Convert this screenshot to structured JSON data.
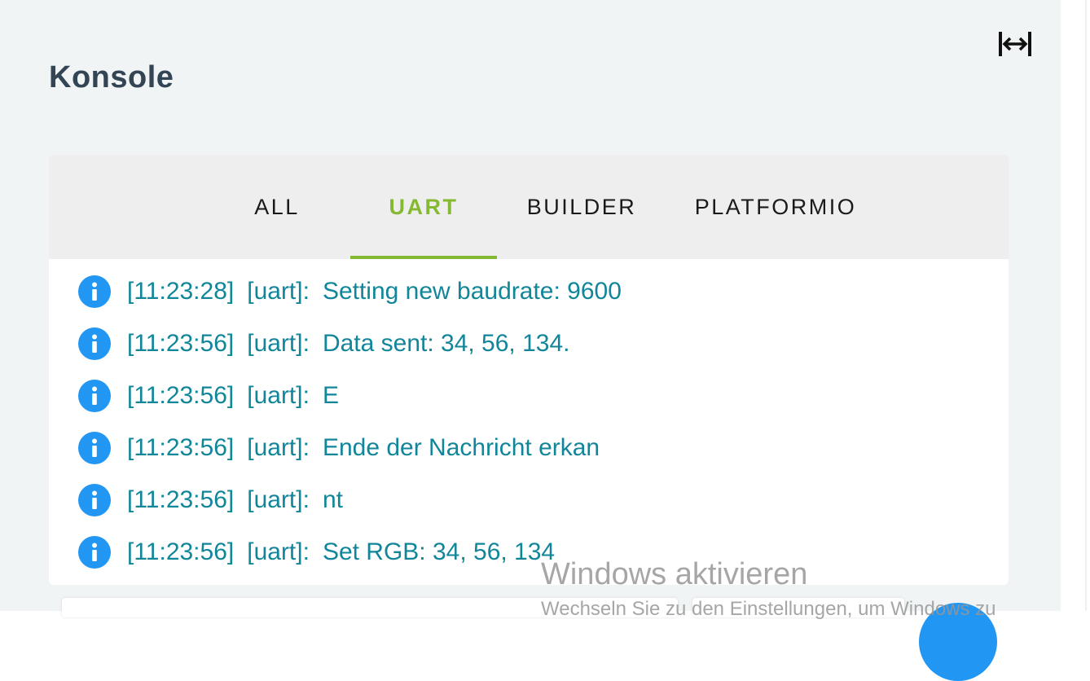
{
  "header": {
    "title": "Konsole",
    "expand_icon": "expand-horizontal-icon"
  },
  "tabs": [
    {
      "label": "ALL",
      "active": false
    },
    {
      "label": "UART",
      "active": true
    },
    {
      "label": "BUILDER",
      "active": false
    },
    {
      "label": "PLATFORMIO",
      "active": false
    }
  ],
  "log": {
    "icon": "info-icon",
    "rows": [
      {
        "time": "[11:23:28]",
        "source": "[uart]:",
        "message": "Setting new baudrate: 9600"
      },
      {
        "time": "[11:23:56]",
        "source": "[uart]:",
        "message": "Data sent: 34, 56, 134."
      },
      {
        "time": "[11:23:56]",
        "source": "[uart]:",
        "message": "E"
      },
      {
        "time": "[11:23:56]",
        "source": "[uart]:",
        "message": "Ende der Nachricht erkan"
      },
      {
        "time": "[11:23:56]",
        "source": "[uart]:",
        "message": "nt"
      },
      {
        "time": "[11:23:56]",
        "source": "[uart]:",
        "message": "Set RGB: 34, 56, 134"
      }
    ]
  },
  "watermark": {
    "title": "Windows aktivieren",
    "subtitle": "Wechseln Sie zu den Einstellungen, um Windows zu"
  },
  "colors": {
    "accent": "#86b932",
    "log_text": "#11869a",
    "info_icon": "#2196f3",
    "title": "#334455"
  }
}
